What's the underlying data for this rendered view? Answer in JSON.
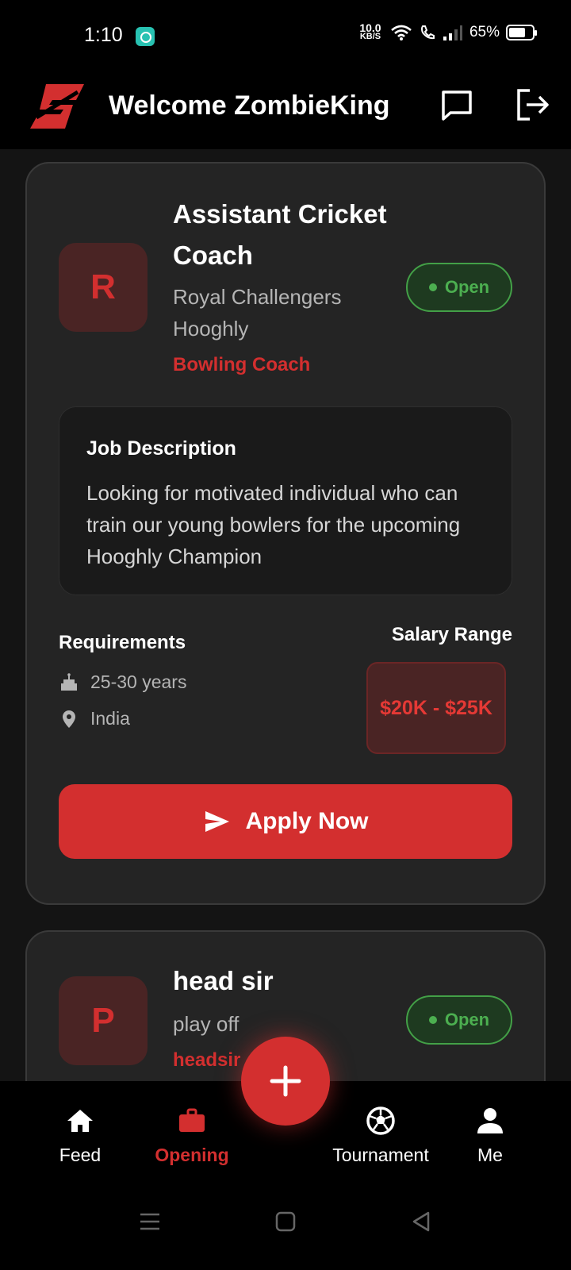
{
  "status_bar": {
    "time": "1:10",
    "net_speed_value": "10.0",
    "net_speed_unit": "KB/S",
    "battery": "65%"
  },
  "app_bar": {
    "title": "Welcome ZombieKing",
    "logo_icon": "brand-logo",
    "chat_icon": "chat-icon",
    "logout_icon": "logout-icon"
  },
  "jobs": [
    {
      "avatar_letter": "R",
      "title": "Assistant Cricket Coach",
      "company": "Royal Challengers Hooghly",
      "category": "Bowling Coach",
      "status": "Open",
      "description_title": "Job Description",
      "description": "Looking for motivated individual who can train our young bowlers for the upcoming Hooghly Champion",
      "requirements_title": "Requirements",
      "age": "25-30 years",
      "location": "India",
      "salary_title": "Salary Range",
      "salary": "$20K - $25K",
      "apply_label": "Apply Now"
    },
    {
      "avatar_letter": "P",
      "title": "head sir",
      "company": "play off",
      "category": "headsir",
      "status": "Open"
    }
  ],
  "bottom_nav": {
    "items": [
      {
        "label": "Feed",
        "icon": "home-icon"
      },
      {
        "label": "Opening",
        "icon": "briefcase-icon",
        "active": true
      },
      {
        "label": "Tournament",
        "icon": "soccer-ball-icon"
      },
      {
        "label": "Me",
        "icon": "person-icon"
      }
    ],
    "fab_icon": "plus-icon"
  },
  "colors": {
    "accent": "#d32f2f",
    "open_green": "#4caf50",
    "card_bg": "#242424",
    "page_bg": "#141414"
  }
}
